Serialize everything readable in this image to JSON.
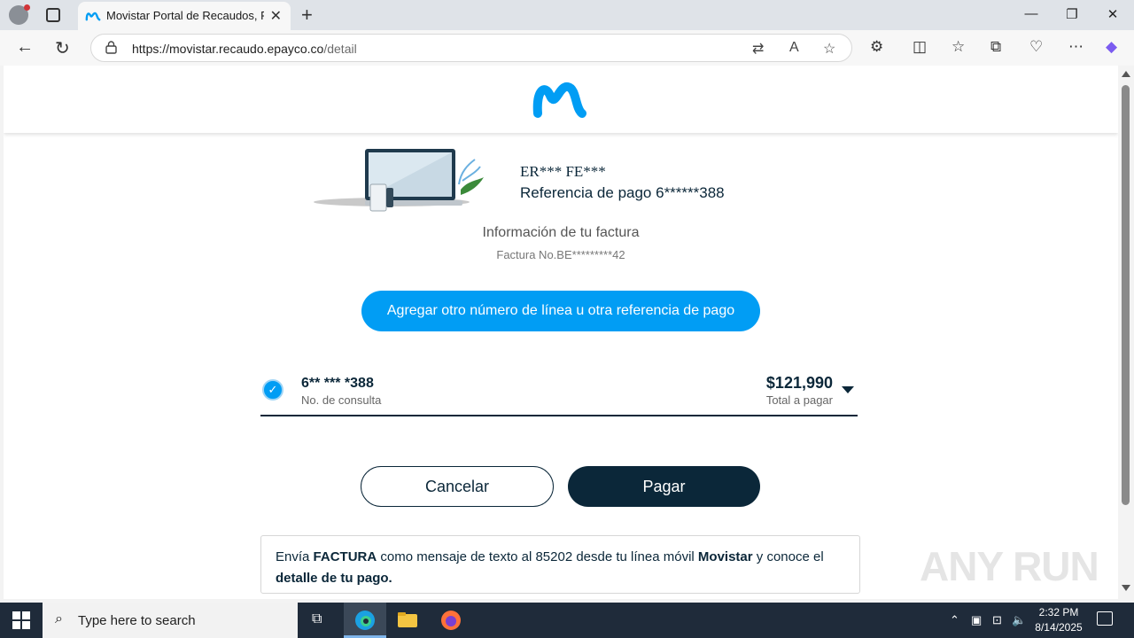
{
  "browser": {
    "tab_title": "Movistar Portal de Recaudos, Pago",
    "url_host": "https://movistar.recaudo.epayco.co",
    "url_path": "/detail"
  },
  "page": {
    "customer_name": "ER*** FE***",
    "payment_reference": "Referencia de pago 6******388",
    "info_title": "Información de tu factura",
    "invoice_number": "Factura No.BE*********42",
    "add_button": "Agregar otro número de línea u otra referencia de pago",
    "line": {
      "number": "6** *** *388",
      "number_label": "No. de consulta",
      "amount": "$121,990",
      "amount_label": "Total a pagar",
      "checked": true
    },
    "cancel_button": "Cancelar",
    "pay_button": "Pagar",
    "sms": {
      "part1": "Envía ",
      "bold1": "FACTURA",
      "part2": " como mensaje de texto al 85202 desde tu línea móvil ",
      "bold2": "Movistar",
      "part3": " y conoce el ",
      "bold3": "detalle de tu pago."
    },
    "colors": {
      "accent": "#019df4",
      "navy": "#0b2739"
    }
  },
  "taskbar": {
    "search_placeholder": "Type here to search",
    "time": "2:32 PM",
    "date": "8/14/2025"
  },
  "watermark": "ANY RUN"
}
